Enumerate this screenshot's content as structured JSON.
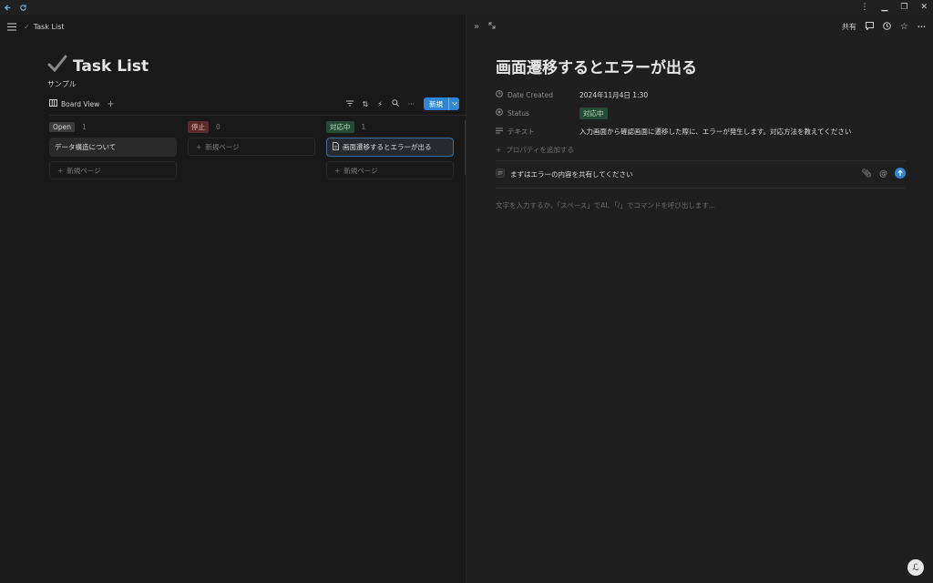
{
  "app": {
    "nav_back_icon": "arrow-left-icon",
    "nav_reload_icon": "reload-icon"
  },
  "left": {
    "breadcrumb": "Task List",
    "title": "Task List",
    "subtitle": "サンプル",
    "view_tab": "Board View",
    "new_button": "新規",
    "columns": [
      {
        "tag": "Open",
        "count": "1",
        "tag_bg": "#3a3a3a",
        "tag_fg": "#d8d8d8",
        "cards": [
          "データ構造について"
        ],
        "new_page": "新規ページ"
      },
      {
        "tag": "停止",
        "count": "0",
        "tag_bg": "#5b2a2a",
        "tag_fg": "#e0b4b4",
        "cards": [],
        "new_page": "新規ページ"
      },
      {
        "tag": "対応中",
        "count": "1",
        "tag_bg": "#254b35",
        "tag_fg": "#b7e0c4",
        "cards": [
          "画面遷移するとエラーが出る"
        ],
        "new_page": "新規ページ"
      }
    ]
  },
  "right": {
    "share": "共有",
    "page_title": "画面遷移するとエラーが出る",
    "props": {
      "date_label": "Date Created",
      "date_value": "2024年11月4日 1:30",
      "status_label": "Status",
      "status_value": "対応中",
      "text_label": "テキスト",
      "text_value": "入力画面から確認画面に遷移した際に、エラーが発生します。対応方法を教えてください",
      "add_property": "プロパティを追加する"
    },
    "comment": "まずはエラーの内容を共有してください",
    "placeholder": "文字を入力するか、「スペース」でAI、「/」でコマンドを呼び出します..."
  },
  "colors": {
    "accent": "#2e86d6",
    "status_green_bg": "#254b35",
    "status_green_fg": "#b7e0c4"
  }
}
